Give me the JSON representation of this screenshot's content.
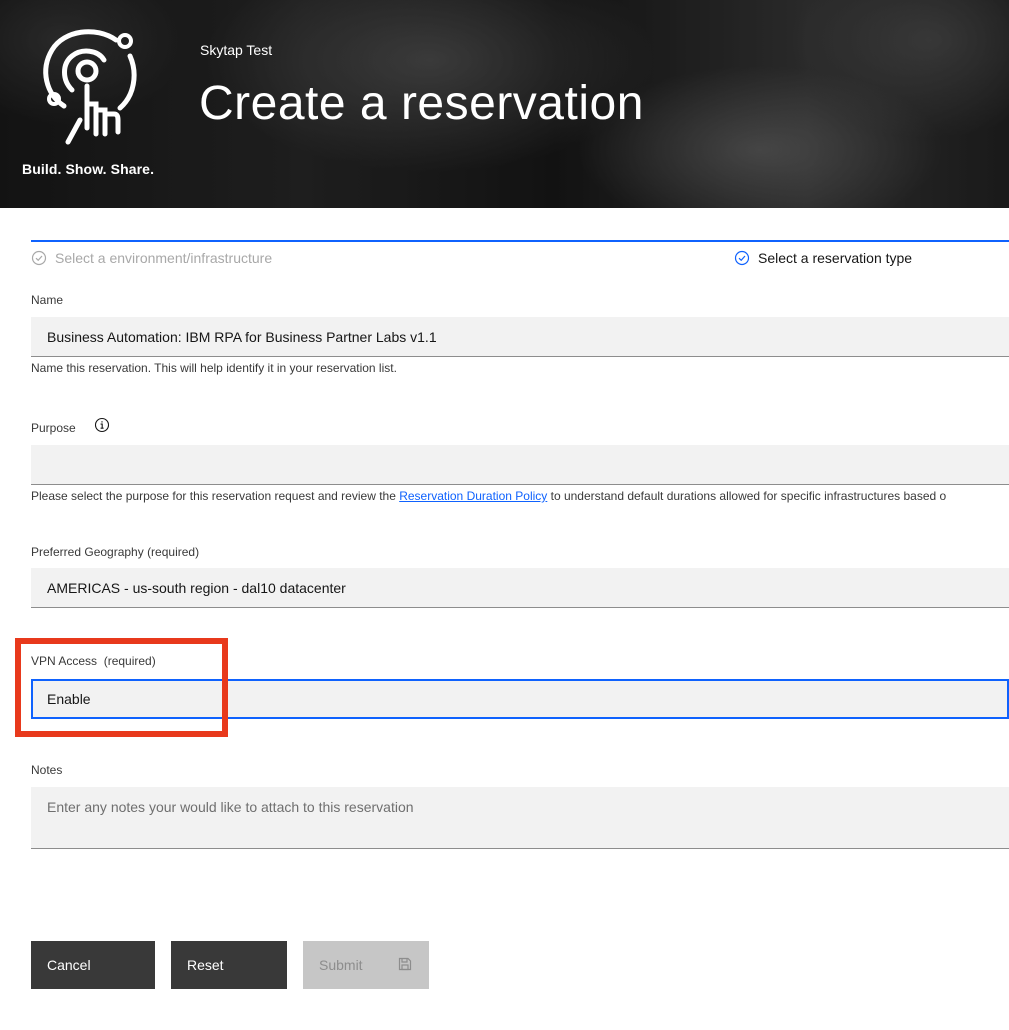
{
  "header": {
    "logo_tagline": "Build. Show. Share.",
    "subtitle": "Skytap Test",
    "title": "Create a reservation"
  },
  "progress": {
    "steps": [
      {
        "label": "Select a environment/infrastructure",
        "state": "complete"
      },
      {
        "label": "Select a reservation type",
        "state": "current"
      }
    ]
  },
  "form": {
    "name": {
      "label": "Name",
      "value": "Business Automation: IBM RPA for Business Partner Labs v1.1",
      "helper": "Name this reservation. This will help identify it in your reservation list."
    },
    "purpose": {
      "label": "Purpose",
      "value": "",
      "helper_prefix": "Please select the purpose for this reservation request and review the ",
      "helper_link": "Reservation Duration Policy",
      "helper_suffix": " to understand default durations allowed for specific infrastructures based o"
    },
    "geography": {
      "label": "Preferred Geography (required)",
      "value": "AMERICAS - us-south region - dal10 datacenter"
    },
    "vpn": {
      "label": "VPN Access",
      "required": "(required)",
      "value": "Enable"
    },
    "notes": {
      "label": "Notes",
      "placeholder": "Enter any notes your would like to attach to this reservation"
    }
  },
  "buttons": {
    "cancel": "Cancel",
    "reset": "Reset",
    "submit": "Submit"
  },
  "colors": {
    "accent": "#0f62fe",
    "highlight": "#e8391c",
    "button_dark": "#393939",
    "button_disabled": "#c6c6c6"
  },
  "icons": {
    "logo": "touch-target-icon",
    "step_complete": "checkmark-outline-icon",
    "step_current": "checkmark-outline-icon",
    "purpose_info": "information-icon",
    "submit": "save-icon"
  }
}
